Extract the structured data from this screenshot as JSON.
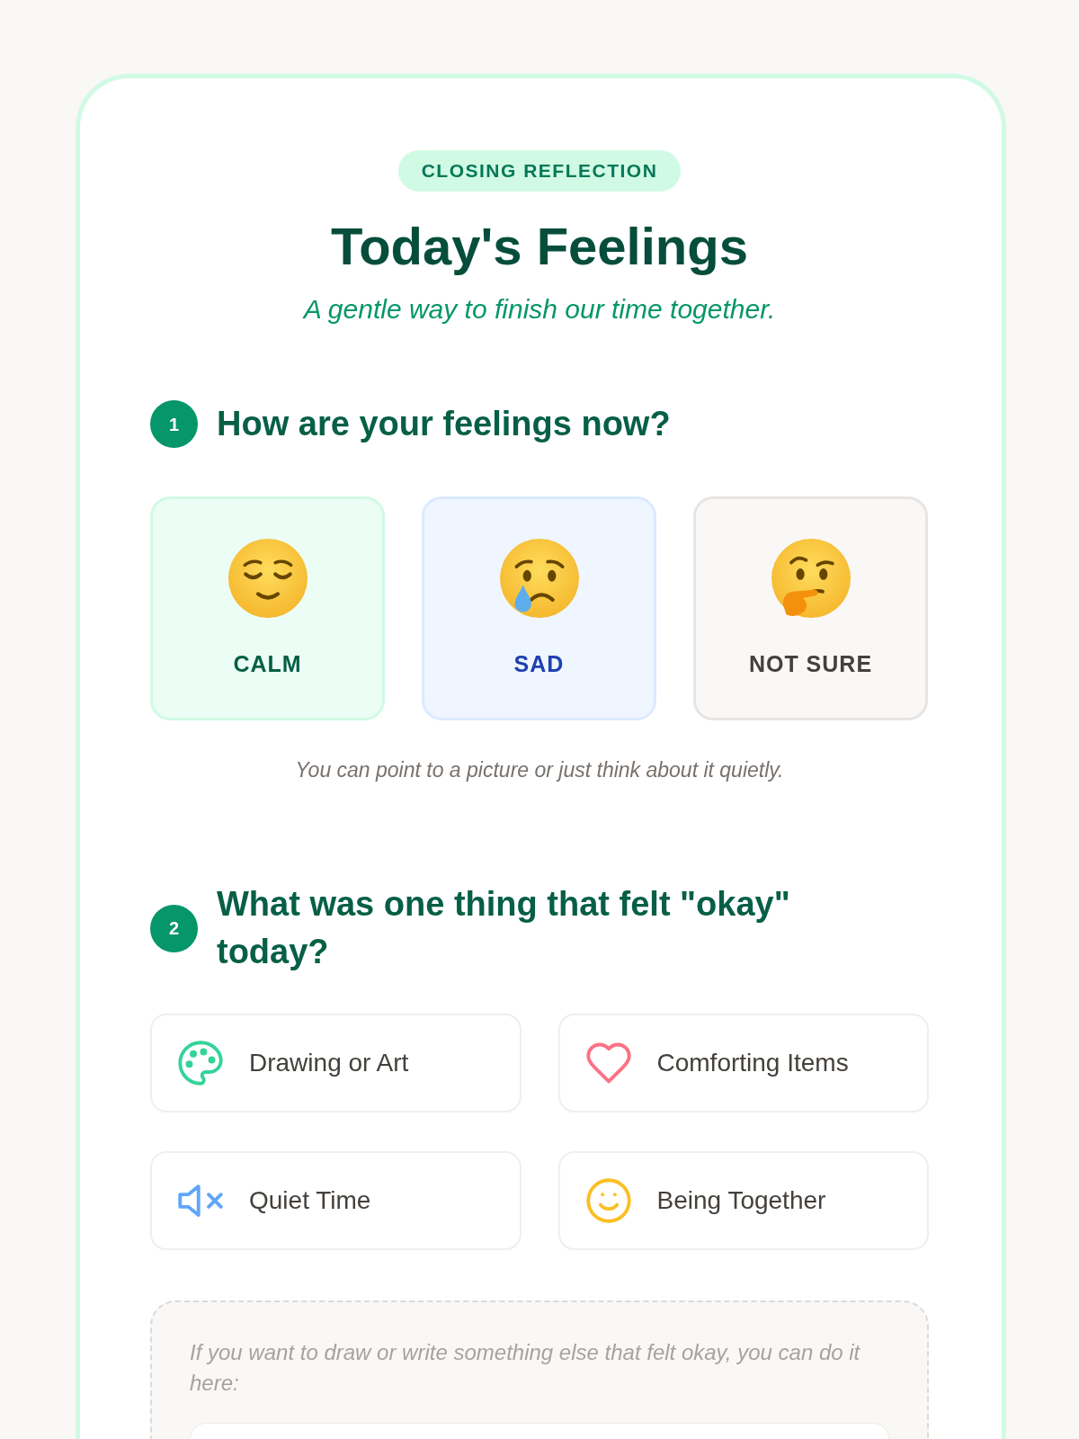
{
  "header": {
    "tag": "CLOSING REFLECTION",
    "title": "Today's Feelings",
    "subtitle": "A gentle way to finish our time together."
  },
  "sections": [
    {
      "kind": "feelings",
      "number": "1",
      "question": "How are your feelings now?",
      "feelings": [
        {
          "kind": "calm",
          "label": "CALM"
        },
        {
          "kind": "sad",
          "label": "SAD"
        },
        {
          "kind": "unsure",
          "label": "NOT SURE"
        }
      ],
      "hint": "You can point to a picture or just think about it quietly."
    },
    {
      "kind": "options",
      "number": "2",
      "question": "What was one thing that felt \"okay\" today?",
      "options": [
        {
          "kind": "art",
          "label": "Drawing or Art"
        },
        {
          "kind": "comfort",
          "label": "Comforting Items"
        },
        {
          "kind": "quiet",
          "label": "Quiet Time"
        },
        {
          "kind": "together",
          "label": "Being Together"
        }
      ],
      "note_prompt": "If you want to draw or write something else that felt okay, you can do it here:"
    }
  ]
}
